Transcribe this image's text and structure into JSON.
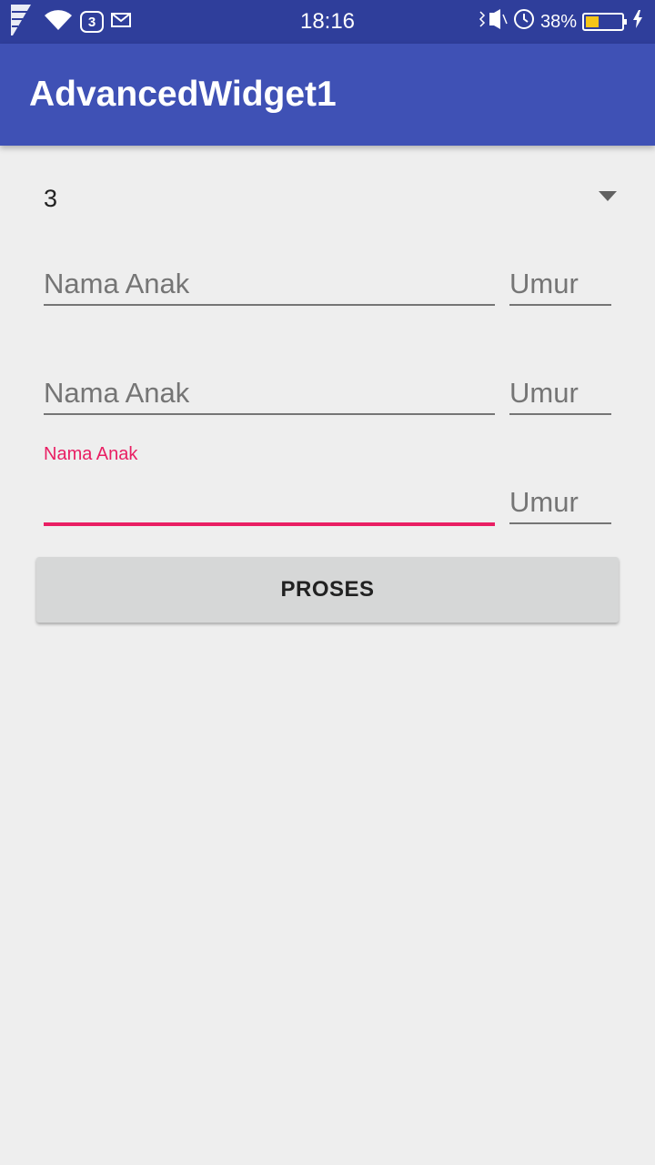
{
  "status_bar": {
    "notification_count": "3",
    "time": "18:16",
    "battery_percent": "38%",
    "battery_level": 0.38,
    "icons": [
      "signal-icon",
      "wifi-icon",
      "mail-icon",
      "vibrate-icon",
      "alarm-icon",
      "battery-icon",
      "charging-icon"
    ]
  },
  "app_bar": {
    "title": "AdvancedWidget1",
    "color": "#3f51b5"
  },
  "spinner": {
    "selected_value": "3"
  },
  "form": {
    "rows": [
      {
        "name_hint": "Nama Anak",
        "age_hint": "Umur"
      },
      {
        "name_hint": "Nama Anak",
        "age_hint": "Umur"
      },
      {
        "name_label": "Nama Anak",
        "name_value": "",
        "age_hint": "Umur",
        "focused": true
      }
    ],
    "accent_color": "#e91e63"
  },
  "button": {
    "label": "PROSES"
  }
}
